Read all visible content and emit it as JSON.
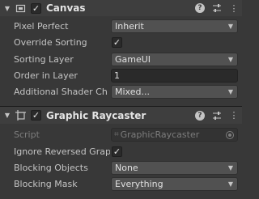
{
  "canvas": {
    "title": "Canvas",
    "enabled": true,
    "fields": {
      "pixel_perfect": {
        "label": "Pixel Perfect",
        "value": "Inherit"
      },
      "override_sorting": {
        "label": "Override Sorting",
        "checked": true
      },
      "sorting_layer": {
        "label": "Sorting Layer",
        "value": "GameUI"
      },
      "order_in_layer": {
        "label": "Order in Layer",
        "value": "1"
      },
      "additional_shader": {
        "label": "Additional Shader Ch",
        "value": "Mixed..."
      }
    }
  },
  "graphic_raycaster": {
    "title": "Graphic Raycaster",
    "enabled": true,
    "fields": {
      "script": {
        "label": "Script",
        "value": "GraphicRaycaster"
      },
      "ignore_reversed": {
        "label": "Ignore Reversed Grap",
        "checked": true
      },
      "blocking_objects": {
        "label": "Blocking Objects",
        "value": "None"
      },
      "blocking_mask": {
        "label": "Blocking Mask",
        "value": "Everything"
      }
    }
  },
  "icons": {
    "foldout": "foldout-triangle-icon",
    "canvas": "canvas-icon",
    "raycaster": "graphic-raycaster-icon",
    "help": "help-icon",
    "presets": "presets-icon",
    "menu": "kebab-menu-icon"
  },
  "colors": {
    "background": "#383838",
    "header": "#3e3e3e",
    "field": "#515151",
    "text": "#c4c4c4"
  }
}
